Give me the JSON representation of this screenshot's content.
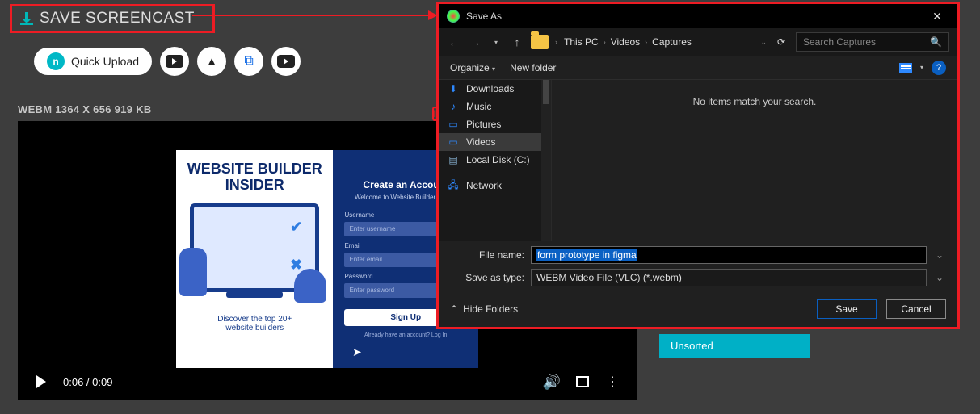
{
  "save_screencast_label": "SAVE SCREENCAST",
  "upload_row": {
    "quick_upload": "Quick Upload"
  },
  "file_info": "WEBM 1364 X 656 919 KB",
  "video": {
    "left_title": "WEBSITE BUILDER INSIDER",
    "left_tag1": "Discover the top 20+",
    "left_tag2": "website builders",
    "right_title": "Create an Account",
    "right_sub": "Welcome to Website Builder Insider",
    "lbl_user": "Username",
    "ph_user": "Enter username",
    "lbl_email": "Email",
    "ph_email": "Enter email",
    "lbl_pass": "Password",
    "ph_pass": "Enter password",
    "signup": "Sign Up",
    "login_line": "Already have an account?  Log In"
  },
  "controls": {
    "time": "0:06 / 0:09"
  },
  "unsorted": "Unsorted",
  "dialog": {
    "title": "Save As",
    "breadcrumb": {
      "pc": "This PC",
      "videos": "Videos",
      "captures": "Captures"
    },
    "search_placeholder": "Search Captures",
    "organize": "Organize",
    "new_folder": "New folder",
    "tree": {
      "downloads": "Downloads",
      "music": "Music",
      "pictures": "Pictures",
      "videos": "Videos",
      "localdisk": "Local Disk (C:)",
      "network": "Network"
    },
    "empty_msg": "No items match your search.",
    "file_name_label": "File name:",
    "file_name_value": "form prototype in figma",
    "save_type_label": "Save as type:",
    "save_type_value": "WEBM Video File (VLC) (*.webm)",
    "hide_folders": "Hide Folders",
    "save_btn": "Save",
    "cancel_btn": "Cancel"
  }
}
